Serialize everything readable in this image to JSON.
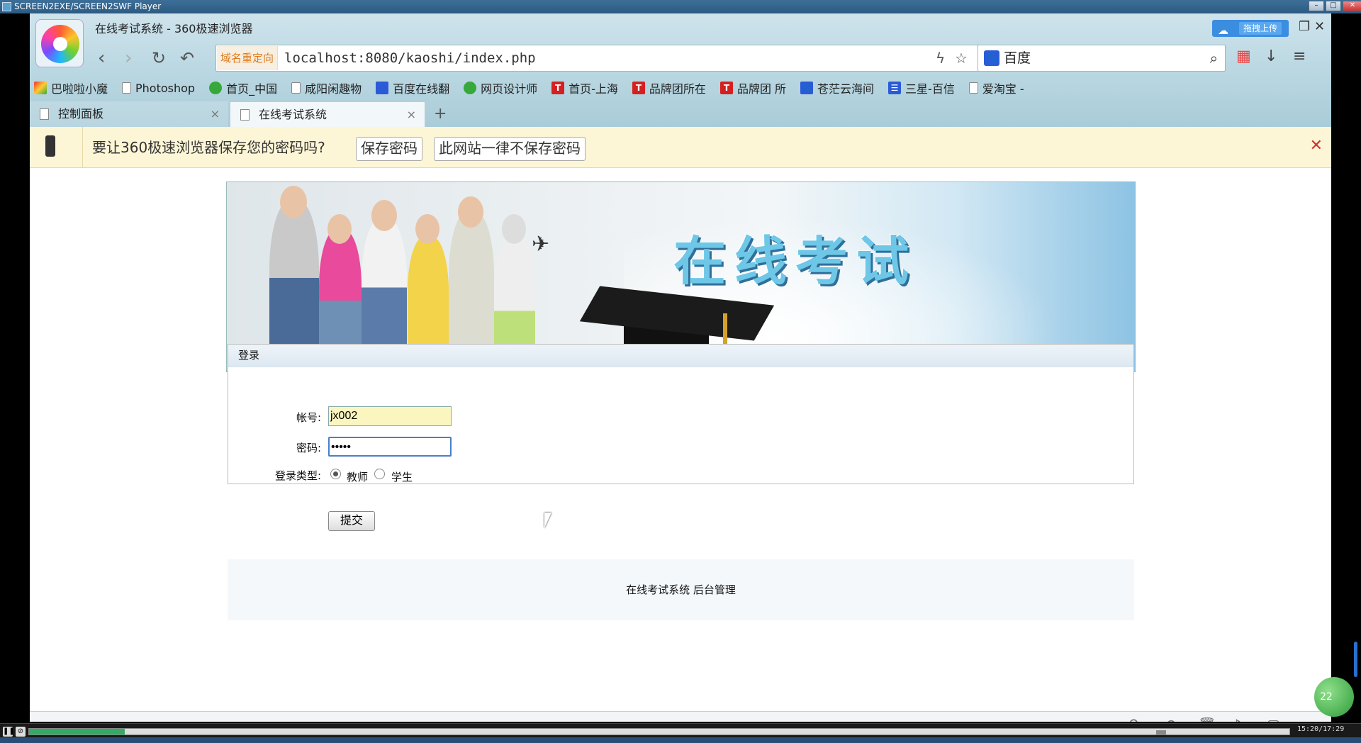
{
  "player": {
    "title": "SCREEN2EXE/SCREEN2SWF Player",
    "timecode": "15:20/17:29"
  },
  "browser": {
    "window_title": "在线考试系统 - 360极速浏览器",
    "cloud_upload": "拖拽上传",
    "redirect_label": "域名重定向",
    "url": "localhost:8080/kaoshi/index.php",
    "search_engine": "百度",
    "bookmarks": [
      "巴啦啦小魔",
      "Photoshop",
      "首页_中国",
      "咸阳闲趣物",
      "百度在线翻",
      "网页设计师",
      "首页-上海",
      "品牌团所在",
      "品牌团 所",
      "苍茫云海间",
      "三星-百信",
      "爱淘宝 -"
    ],
    "tabs": [
      {
        "label": "控制面板"
      },
      {
        "label": "在线考试系统"
      }
    ],
    "tab_add": "+"
  },
  "password_bar": {
    "question": "要让360极速浏览器保存您的密码吗?",
    "save": "保存密码",
    "never": "此网站一律不保存密码"
  },
  "banner": {
    "title": "在线考试"
  },
  "login": {
    "header": "登录",
    "account_label": "帐号:",
    "account_value": "jx002",
    "password_label": "密码:",
    "password_value": "•••••",
    "type_label": "登录类型:",
    "options": [
      "教师",
      "学生"
    ],
    "selected": "教师",
    "submit": "提交"
  },
  "footer": {
    "text": "在线考试系统  后台管理"
  },
  "status_badge": "22"
}
